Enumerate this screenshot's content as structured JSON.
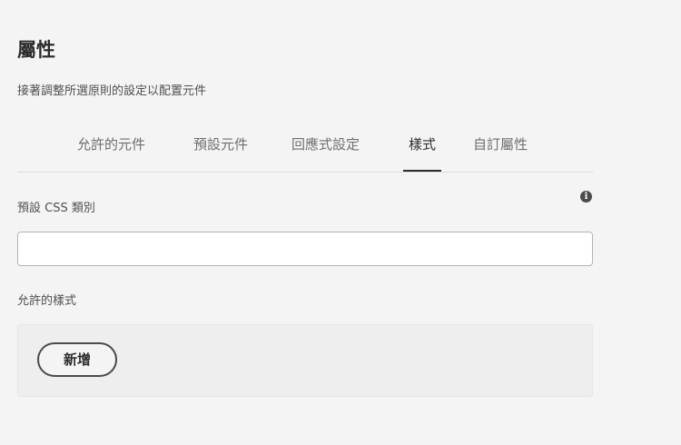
{
  "header": {
    "title": "屬性",
    "subtitle": "接著調整所選原則的設定以配置元件"
  },
  "tabs": [
    {
      "label": "允許的元件",
      "active": false
    },
    {
      "label": "預設元件",
      "active": false
    },
    {
      "label": "回應式設定",
      "active": false
    },
    {
      "label": "樣式",
      "active": true
    },
    {
      "label": "自訂屬性",
      "active": false
    }
  ],
  "default_css": {
    "label": "預設 CSS 類別",
    "value": "",
    "placeholder": "",
    "info_icon": "info-icon"
  },
  "allowed_styles": {
    "label": "允許的樣式",
    "add_button_label": "新增"
  }
}
